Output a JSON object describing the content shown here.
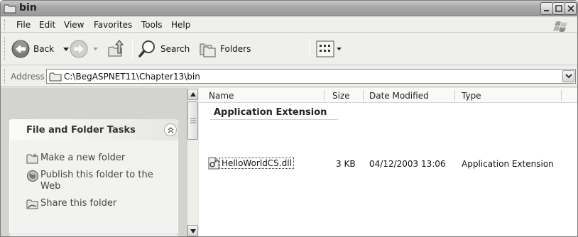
{
  "window": {
    "title": "bin"
  },
  "menu": {
    "items": [
      "File",
      "Edit",
      "View",
      "Favorites",
      "Tools",
      "Help"
    ]
  },
  "toolbar": {
    "back_label": "Back",
    "search_label": "Search",
    "folders_label": "Folders",
    "icons": [
      "back-arrow-icon",
      "forward-arrow-icon",
      "up-folder-icon",
      "search-icon",
      "folders-icon",
      "views-icon"
    ]
  },
  "address": {
    "label": "Address",
    "value": "C:\\BegASPNET11\\Chapter13\\bin"
  },
  "tasks": {
    "title": "File and Folder Tasks",
    "items": [
      {
        "label": "Make a new folder",
        "icon": "new-folder-icon"
      },
      {
        "label": "Publish this folder to the Web",
        "icon": "publish-web-icon"
      },
      {
        "label": "Share this folder",
        "icon": "share-folder-icon"
      }
    ]
  },
  "filelist": {
    "columns": [
      "Name",
      "Size",
      "Date Modified",
      "Type"
    ],
    "group": "Application Extension",
    "rows": [
      {
        "name": "HelloWorldCS.dll",
        "size": "3 KB",
        "modified": "04/12/2003 13:06",
        "type": "Application Extension",
        "icon": "dll-file-icon"
      }
    ]
  }
}
